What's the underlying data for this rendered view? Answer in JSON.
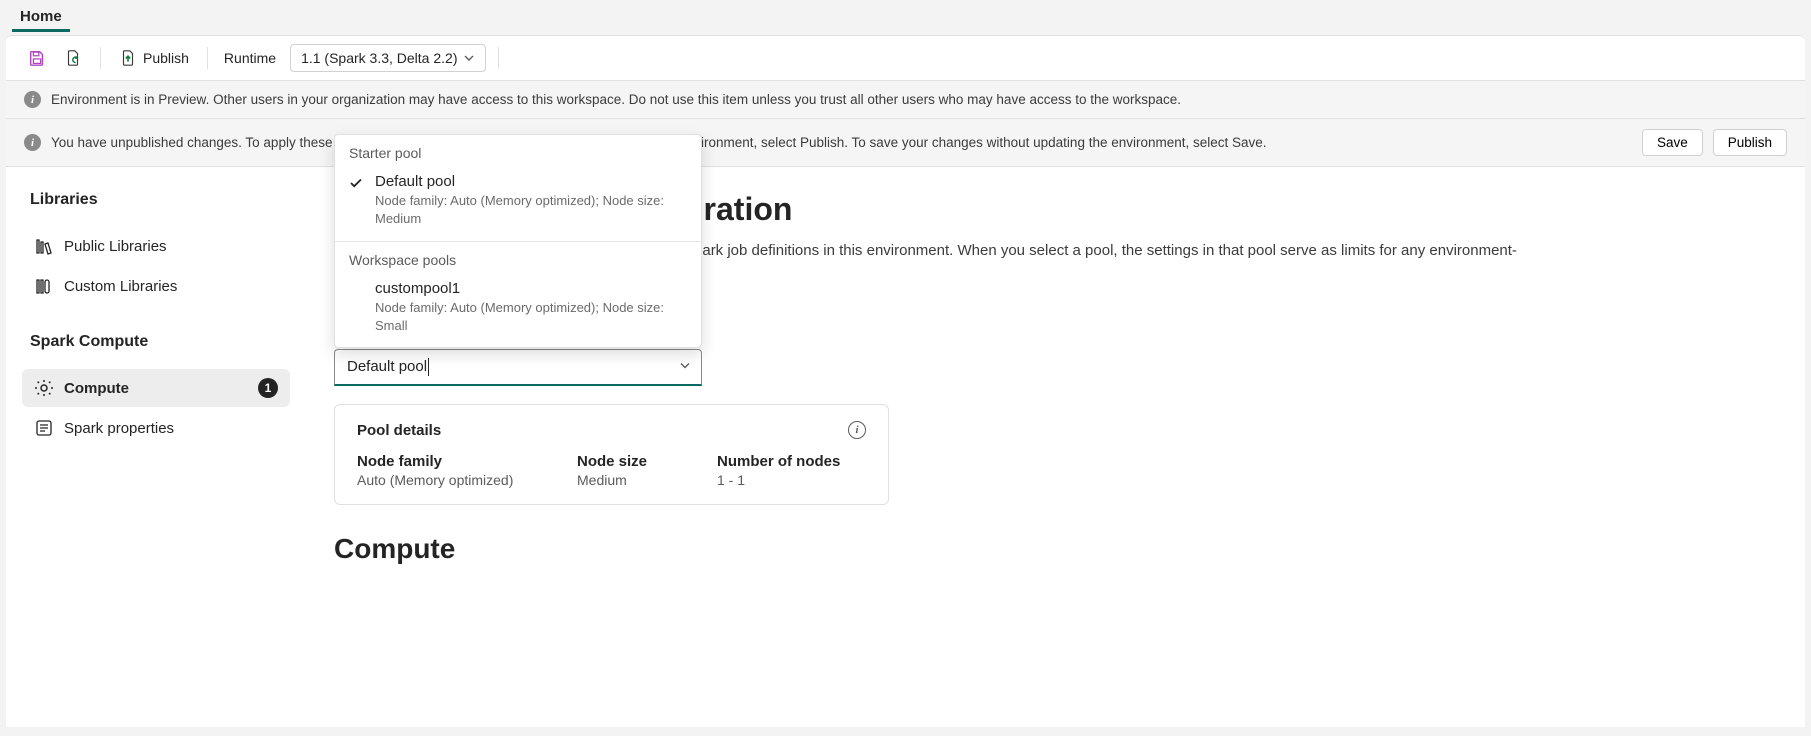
{
  "tab": {
    "home": "Home"
  },
  "toolbar": {
    "publish": "Publish",
    "runtime_label": "Runtime",
    "runtime_value": "1.1 (Spark 3.3, Delta 2.2)"
  },
  "banner1": "Environment is in Preview. Other users in your organization may have access to this workspace. Do not use this item unless you trust all other users who may have access to the workspace.",
  "banner2": {
    "msg": "You have unpublished changes. To apply these changes to notebooks and Spark job definition run in this environment, select Publish. To save your changes without updating the environment, select Save.",
    "save": "Save",
    "publish": "Publish"
  },
  "sidebar": {
    "section1": "Libraries",
    "public": "Public Libraries",
    "custom": "Custom Libraries",
    "section2": "Spark Compute",
    "compute": "Compute",
    "compute_badge": "1",
    "spark_props": "Spark properties"
  },
  "page": {
    "title_visible": "uration",
    "desc_visible": "Spark job definitions in this environment. When you select a pool, the settings in that pool serve as limits for any environment-"
  },
  "pool_select": {
    "value": "Default pool"
  },
  "dropdown": {
    "group1": "Starter pool",
    "item1_title": "Default pool",
    "item1_sub": "Node family: Auto (Memory optimized); Node size: Medium",
    "group2": "Workspace pools",
    "item2_title": "custompool1",
    "item2_sub": "Node family: Auto (Memory optimized); Node size: Small"
  },
  "pool_details": {
    "title": "Pool details",
    "node_family_k": "Node family",
    "node_family_v": "Auto (Memory optimized)",
    "node_size_k": "Node size",
    "node_size_v": "Medium",
    "num_nodes_k": "Number of nodes",
    "num_nodes_v": "1 - 1"
  },
  "compute_section": "Compute"
}
